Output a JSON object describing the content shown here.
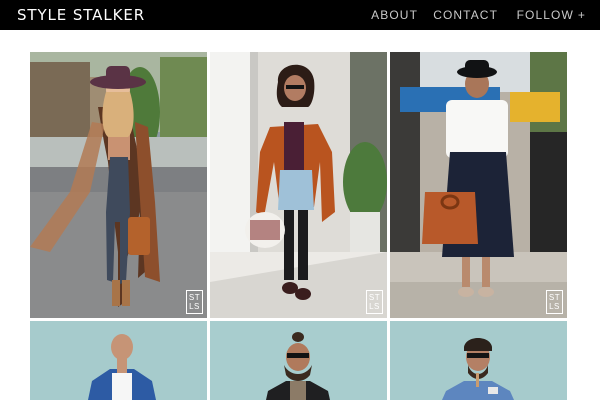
{
  "header": {
    "brand": "STYLE STALKER",
    "nav": {
      "about": "ABOUT",
      "contact": "CONTACT",
      "follow": "FOLLOW",
      "follow_icon": "+"
    }
  },
  "watermark": {
    "line1": "ST",
    "line2": "LS"
  },
  "gallery": [
    {
      "name": "woman-in-hat-and-fringe-kimono"
    },
    {
      "name": "woman-in-rust-coat-with-handbag"
    },
    {
      "name": "woman-in-white-shirt-and-navy-skirt"
    },
    {
      "name": "man-in-denim-jacket"
    },
    {
      "name": "man-with-topknot-and-sunglasses"
    },
    {
      "name": "man-with-sunglasses-and-lapel-badge"
    }
  ],
  "colors": {
    "header_bg": "#000000",
    "nav_text": "#c9c9c9",
    "brand_text": "#ffffff",
    "backdrop": "#a6cbcc"
  }
}
